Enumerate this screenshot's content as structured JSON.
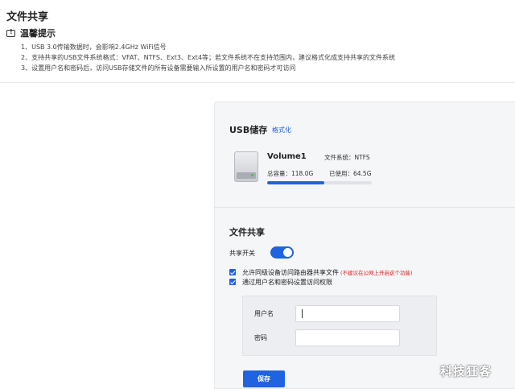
{
  "page": {
    "title": "文件共享"
  },
  "tips": {
    "heading": "温馨提示",
    "lines": [
      "1、USB 3.0传输数据时，会影响2.4GHz WiFi信号",
      "2、支持共享的USB文件系统格式：VFAT、NTFS、Ext3、Ext4等；若文件系统不在支持范围内，建议格式化成支持共享的文件系统",
      "3、设置用户名和密码后，访问USB存储文件的所有设备需要输入所设置的用户名和密码才可访问"
    ]
  },
  "usb": {
    "title": "USB储存",
    "format_link": "格式化",
    "volume": {
      "name": "Volume1",
      "fs_text": "文件系统：NTFS",
      "total_text": "总容量：118.0G",
      "used_text": "已使用：64.5G",
      "used_fraction": 0.547
    }
  },
  "share": {
    "title": "文件共享",
    "switch_label": "共享开关",
    "switch_on": true,
    "option1_label": "允许同级设备访问路由器共享文件",
    "option1_warning": "(不建议在公网上开启这个功能)",
    "option2_label": "通过用户名和密码设置访问权限",
    "username_label": "用户名",
    "username_value": "",
    "password_label": "密码",
    "password_value": "",
    "save_label": "保存"
  },
  "colors": {
    "accent": "#1f63e0",
    "warning": "#e02020"
  },
  "watermark": "科技狂客"
}
